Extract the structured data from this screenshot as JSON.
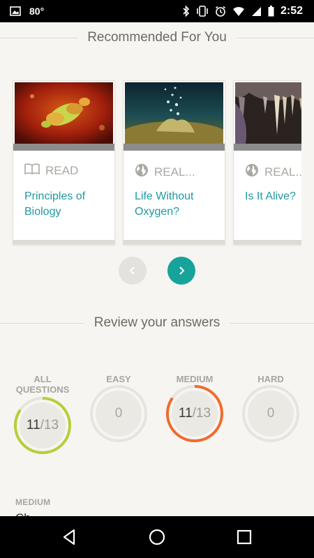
{
  "status_bar": {
    "temperature": "80°",
    "time": "2:52"
  },
  "recommended": {
    "heading": "Recommended For You",
    "cards": [
      {
        "type_label": "READ",
        "type_icon": "book-icon",
        "title": "Principles of Biology"
      },
      {
        "type_label": "REAL...",
        "type_icon": "globe-icon",
        "title": "Life Without Oxygen?"
      },
      {
        "type_label": "REAL...",
        "type_icon": "globe-icon",
        "title": "Is It Alive?"
      }
    ],
    "prev_label": "‹",
    "next_label": "›"
  },
  "review": {
    "heading": "Review your answers",
    "stats": [
      {
        "label": "ALL QUESTIONS",
        "correct": "11",
        "total": "/13",
        "fraction": 0.846,
        "color": "#b5cf3a"
      },
      {
        "label": "EASY",
        "value": "0",
        "fraction": 0,
        "color": "#e6e4df"
      },
      {
        "label": "MEDIUM",
        "correct": "11",
        "total": "/13",
        "fraction": 0.846,
        "color": "#f06b2e"
      },
      {
        "label": "HARD",
        "value": "0",
        "fraction": 0,
        "color": "#e6e4df"
      }
    ]
  },
  "detail": {
    "section_label": "MEDIUM",
    "preview_text": "Ch"
  },
  "colors": {
    "accent": "#17a39a",
    "link": "#1e9aa0",
    "easy_ring": "#b5cf3a",
    "medium_ring": "#f06b2e"
  }
}
